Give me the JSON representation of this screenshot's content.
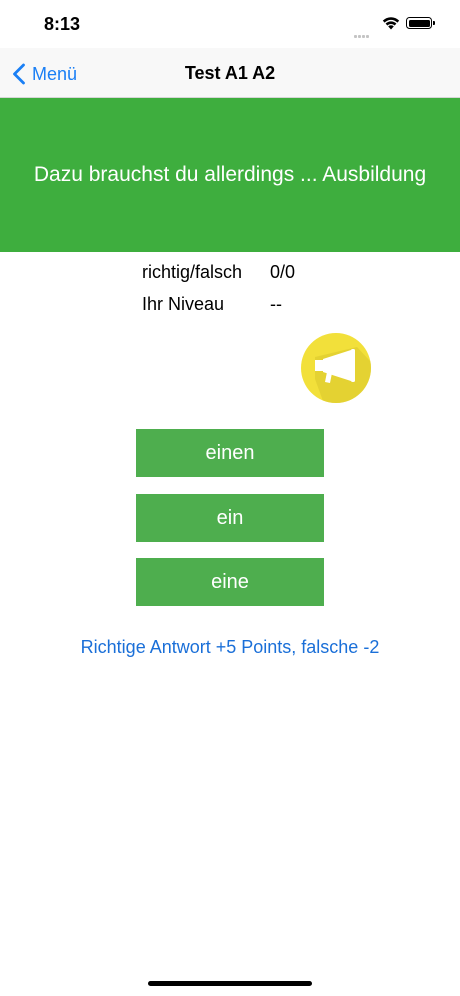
{
  "status_bar": {
    "time": "8:13",
    "icons": [
      "signal-icon",
      "wifi-icon",
      "battery-icon"
    ]
  },
  "nav": {
    "back_label": "Menü",
    "title": "Test A1 A2"
  },
  "question": {
    "text": "Dazu brauchst du allerdings ... Ausbildung"
  },
  "stats": {
    "correct_label": "richtig/falsch",
    "correct_value": "0/0",
    "level_label": "Ihr Niveau",
    "level_value": "--"
  },
  "speaker": {
    "icon": "megaphone-icon"
  },
  "answers": [
    {
      "label": "einen"
    },
    {
      "label": "ein"
    },
    {
      "label": "eine"
    }
  ],
  "scoring_note": "Richtige Antwort +5 Points, falsche -2",
  "colors": {
    "banner": "#3eae3e",
    "answer_button": "#4eae4e",
    "accent": "#1a7ff5",
    "speaker": "#f2e03a"
  }
}
